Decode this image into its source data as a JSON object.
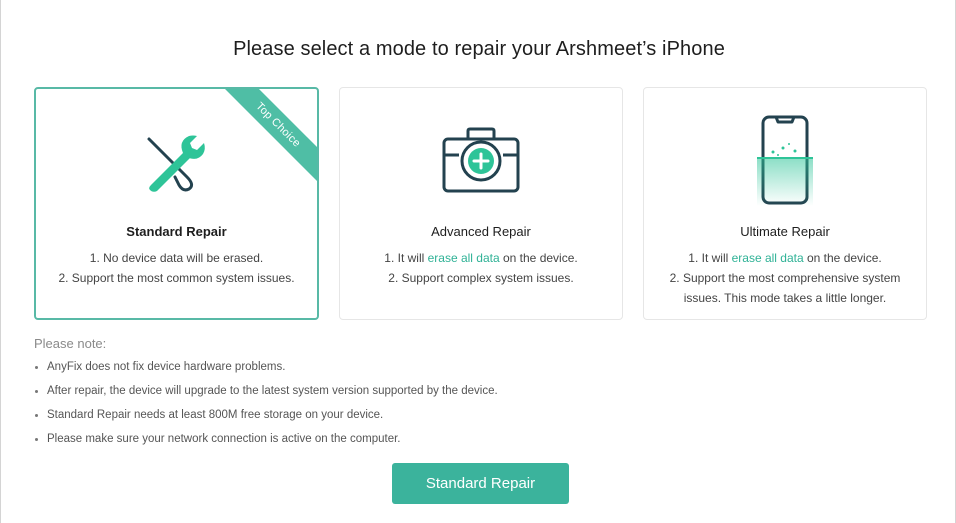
{
  "header": {
    "title": "Please select a mode to repair your Arshmeet’s iPhone"
  },
  "colors": {
    "accent": "#3bb39c",
    "accent_text": "#2fb296",
    "selected_border": "#58b9a6",
    "ribbon": "#4fbea5",
    "icon_dark": "#23424f"
  },
  "modes": [
    {
      "title": "Standard Repair",
      "icon": "wrench-screwdriver-icon",
      "selected": true,
      "badge": "Top Choice",
      "line1": "1. No device data will be erased.",
      "line2": "2. Support the most common system issues."
    },
    {
      "title": "Advanced Repair",
      "icon": "toolbox-icon",
      "selected": false,
      "line1_pre": "1. It will ",
      "line1_hl": "erase all data",
      "line1_post": " on the device.",
      "line2": "2. Support complex system issues."
    },
    {
      "title": "Ultimate Repair",
      "icon": "phone-scan-icon",
      "selected": false,
      "line1_pre": "1. It will ",
      "line1_hl": "erase all data",
      "line1_post": " on the device.",
      "line2": "2. Support the most comprehensive system issues. This mode takes a little longer."
    }
  ],
  "notes": {
    "title": "Please note:",
    "items": [
      "AnyFix does not fix device hardware problems.",
      "After repair, the device will upgrade to the latest system version supported by the device.",
      "Standard Repair needs at least 800M free storage on your device.",
      "Please make sure your network connection is active on the computer."
    ]
  },
  "action": {
    "button_label": "Standard Repair"
  }
}
